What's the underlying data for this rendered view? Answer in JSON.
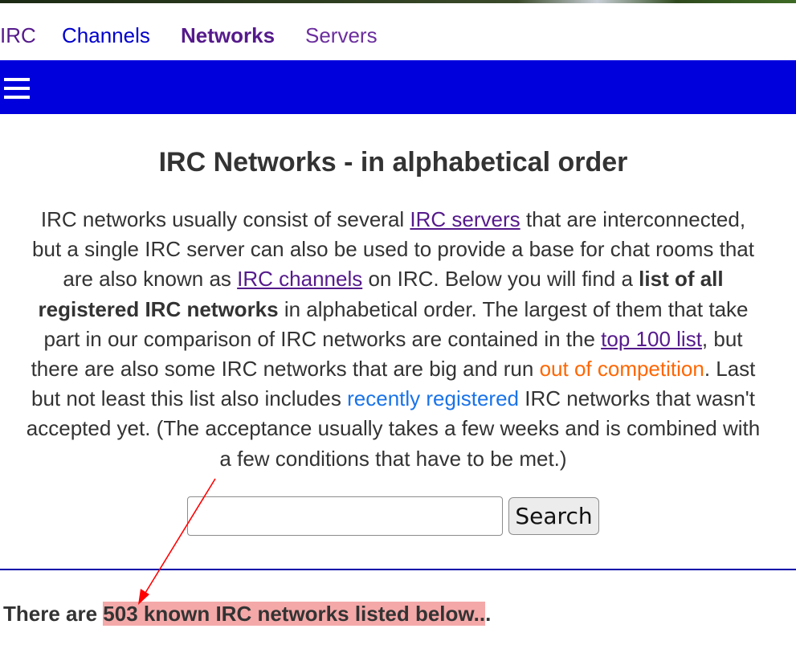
{
  "topnav": {
    "items": [
      {
        "label": "IRC"
      },
      {
        "label": "Channels"
      },
      {
        "label": "Networks"
      },
      {
        "label": "Servers"
      }
    ]
  },
  "menu": {
    "icon": "hamburger-menu-icon"
  },
  "heading": "IRC Networks - in alphabetical order",
  "intro": {
    "t1": "IRC networks usually consist of several ",
    "link_servers": "IRC servers",
    "t2": " that are interconnected,",
    "t3": "but a single IRC server can also be used to provide a base for chat rooms that",
    "t4": "are also known as ",
    "link_channels": "IRC channels",
    "t5": " on IRC. Below you will find a ",
    "b1": "list of all",
    "b2": "registered IRC networks",
    "t6": " in alphabetical order. The largest of them that take",
    "t7": "part in our comparison of IRC networks are contained in the ",
    "link_top100": "top 100 list",
    "t8": ", but",
    "t9": "there are also some IRC networks that are big and run ",
    "link_competition": "out of competition",
    "t10": ". Last",
    "t11": "but not least this list also includes ",
    "link_recent": "recently registered",
    "t12": " IRC networks that wasn't",
    "t13": "accepted yet. (The acceptance usually takes a few weeks and is combined with",
    "t14": "a few conditions that have to be met.)"
  },
  "search": {
    "value": "",
    "button_label": "Search"
  },
  "count": {
    "prefix": "There are ",
    "highlight": "503 known IRC networks listed below..",
    "suffix": "."
  },
  "colors": {
    "menubar": "#0000dd",
    "link_visited": "#551a8b",
    "link_blue": "#0000cc",
    "orange": "#ff6600",
    "light_blue": "#1a73e8",
    "highlight": "#f4a8a8",
    "annotation_arrow": "#ff0000"
  }
}
